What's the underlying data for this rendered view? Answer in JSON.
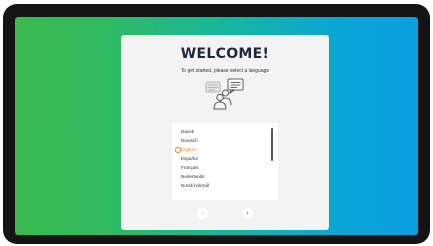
{
  "welcome": {
    "title": "WELCOME!",
    "subtitle": "To get started, please select a language",
    "illustration_icon": "people-chat-icon"
  },
  "languages": [
    {
      "label": "Dansk",
      "selected": false
    },
    {
      "label": "Deutsch",
      "selected": false
    },
    {
      "label": "English",
      "selected": true
    },
    {
      "label": "Español",
      "selected": false
    },
    {
      "label": "Français",
      "selected": false
    },
    {
      "label": "Nederlands",
      "selected": false
    },
    {
      "label": "Norsk bokmål",
      "selected": false
    }
  ],
  "navigation": {
    "prev_icon": "‹",
    "next_icon": "›"
  },
  "colors": {
    "accent": "#f08a24",
    "title": "#1e2a3a",
    "gradient_start": "#3cb94f",
    "gradient_end": "#0a9fe0"
  }
}
